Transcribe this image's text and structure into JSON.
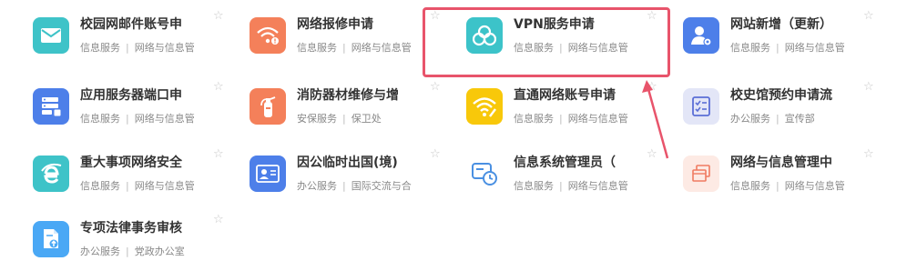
{
  "services": [
    {
      "title": "校园网邮件账号申",
      "tag1": "信息服务",
      "tag2": "网络与信息管",
      "icon": "mail-icon",
      "color": "#3ec3c8"
    },
    {
      "title": "网络报修申请",
      "tag1": "信息服务",
      "tag2": "网络与信息管",
      "icon": "wifi-warning-icon",
      "color": "#f4805a"
    },
    {
      "title": "VPN服务申请",
      "tag1": "信息服务",
      "tag2": "网络与信息管",
      "icon": "vpn-cloud-icon",
      "color": "#3cc3c9"
    },
    {
      "title": "网站新增（更新）",
      "tag1": "信息服务",
      "tag2": "网络与信息管",
      "icon": "user-settings-icon",
      "color": "#4d7fe9"
    },
    {
      "title": "应用服务器端口申",
      "tag1": "信息服务",
      "tag2": "网络与信息管",
      "icon": "server-icon",
      "color": "#4d7fe9"
    },
    {
      "title": "消防器材维修与增",
      "tag1": "安保服务",
      "tag2": "保卫处",
      "icon": "fire-extinguisher-icon",
      "color": "#f4805a"
    },
    {
      "title": "直通网络账号申请",
      "tag1": "信息服务",
      "tag2": "网络与信息管",
      "icon": "wifi-icon",
      "color": "#f8c80a"
    },
    {
      "title": "校史馆预约申请流",
      "tag1": "办公服务",
      "tag2": "宣传部",
      "icon": "checklist-icon",
      "color": "#e3e6f7"
    },
    {
      "title": "重大事项网络安全",
      "tag1": "信息服务",
      "tag2": "网络与信息管",
      "icon": "browser-e-icon",
      "color": "#3ec3c8"
    },
    {
      "title": "因公临时出国(境)",
      "tag1": "办公服务",
      "tag2": "国际交流与合",
      "icon": "id-card-icon",
      "color": "#4d7fe9"
    },
    {
      "title": "信息系统管理员（",
      "tag1": "信息服务",
      "tag2": "网络与信息管",
      "icon": "system-clock-icon",
      "color": "#ffffff"
    },
    {
      "title": "网络与信息管理中",
      "tag1": "信息服务",
      "tag2": "网络与信息管",
      "icon": "windows-icon",
      "color": "#fdeae4"
    },
    {
      "title": "专项法律事务审核",
      "tag1": "办公服务",
      "tag2": "党政办公室",
      "icon": "document-upload-icon",
      "color": "#4aa8f5"
    }
  ]
}
